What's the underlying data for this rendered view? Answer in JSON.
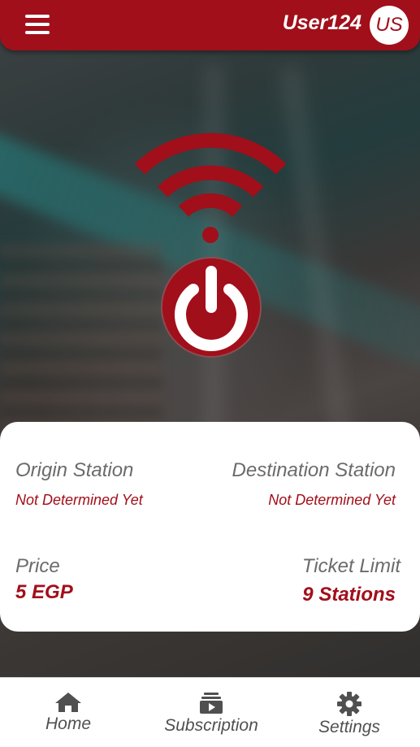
{
  "header": {
    "username": "User124",
    "avatar_initials": "US",
    "menu_icon": "hamburger-menu-icon"
  },
  "colors": {
    "brand_red": "#a10f1a",
    "label_gray": "#6b6b6b",
    "card_bg": "#ffffff"
  },
  "main": {
    "wifi_icon": "wifi-signal-icon",
    "power_icon": "power-icon"
  },
  "trip_card": {
    "origin_label": "Origin Station",
    "origin_value": "Not Determined Yet",
    "destination_label": "Destination Station",
    "destination_value": "Not Determined Yet",
    "price_label": "Price",
    "price_value": "5 EGP",
    "limit_label": "Ticket Limit",
    "limit_value": "9 Stations"
  },
  "bottom_nav": {
    "items": [
      {
        "label": "Home",
        "icon": "home-icon"
      },
      {
        "label": "Subscription",
        "icon": "subscription-icon"
      },
      {
        "label": "Settings",
        "icon": "gear-icon"
      }
    ]
  }
}
